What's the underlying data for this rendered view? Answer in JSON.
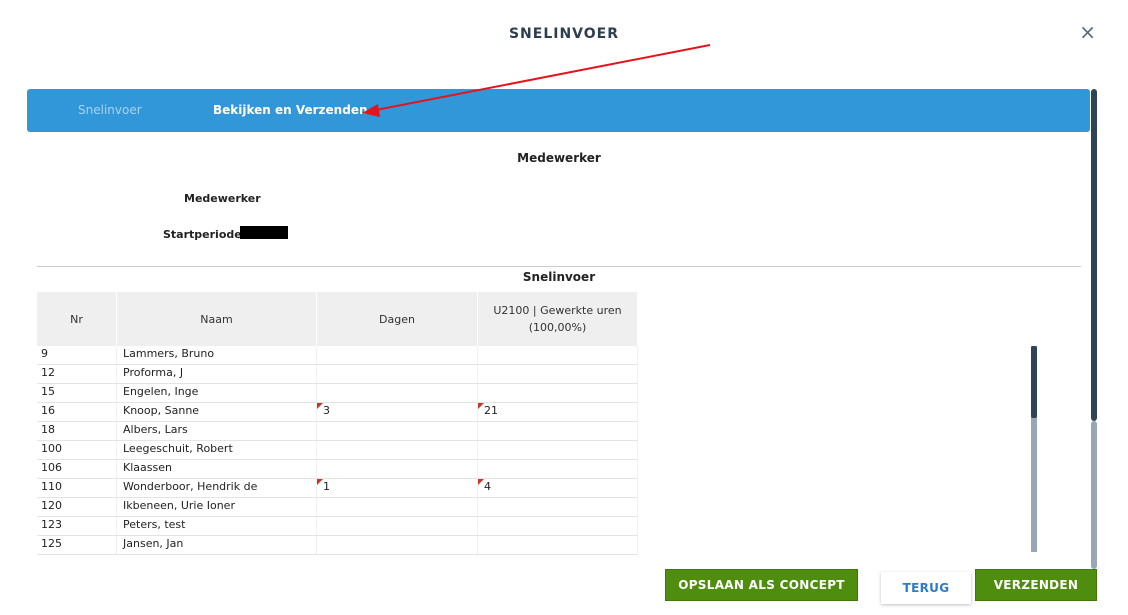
{
  "modal": {
    "title": "SNELINVOER",
    "close_symbol": "×"
  },
  "tabs": [
    {
      "label": "Snelinvoer",
      "active": false
    },
    {
      "label": "Bekijken en Verzenden",
      "active": true
    }
  ],
  "employee_section": {
    "heading": "Medewerker",
    "medewerker_label": "Medewerker",
    "startperiode_label": "Startperiode"
  },
  "snelinvoer_section": {
    "heading": "Snelinvoer",
    "columns": [
      "Nr",
      "Naam",
      "Dagen",
      "U2100 | Gewerkte uren (100,00%)"
    ],
    "rows": [
      {
        "nr": "9",
        "naam": "Lammers, Bruno",
        "dagen": "",
        "uren": ""
      },
      {
        "nr": "12",
        "naam": "Proforma, J",
        "dagen": "",
        "uren": ""
      },
      {
        "nr": "15",
        "naam": "Engelen, Inge",
        "dagen": "",
        "uren": ""
      },
      {
        "nr": "16",
        "naam": "Knoop, Sanne",
        "dagen": "3",
        "uren": "21"
      },
      {
        "nr": "18",
        "naam": "Albers, Lars",
        "dagen": "",
        "uren": ""
      },
      {
        "nr": "100",
        "naam": "Leegeschuit, Robert",
        "dagen": "",
        "uren": ""
      },
      {
        "nr": "106",
        "naam": "Klaassen",
        "dagen": "",
        "uren": ""
      },
      {
        "nr": "110",
        "naam": "Wonderboor, Hendrik de",
        "dagen": "1",
        "uren": "4"
      },
      {
        "nr": "120",
        "naam": "Ikbeneen, Urie Ioner",
        "dagen": "",
        "uren": ""
      },
      {
        "nr": "123",
        "naam": "Peters, test",
        "dagen": "",
        "uren": ""
      },
      {
        "nr": "125",
        "naam": "Jansen, Jan",
        "dagen": "",
        "uren": ""
      }
    ]
  },
  "buttons": {
    "save_concept": "OPSLAAN ALS CONCEPT",
    "back": "TERUG",
    "send": "VERZENDEN"
  },
  "colors": {
    "tabbar": "#3197d8",
    "primary_green": "#4f8d0f",
    "link_blue": "#2b7cc4",
    "annotation_arrow": "#e3141b",
    "changed_flag": "#c0392b"
  }
}
